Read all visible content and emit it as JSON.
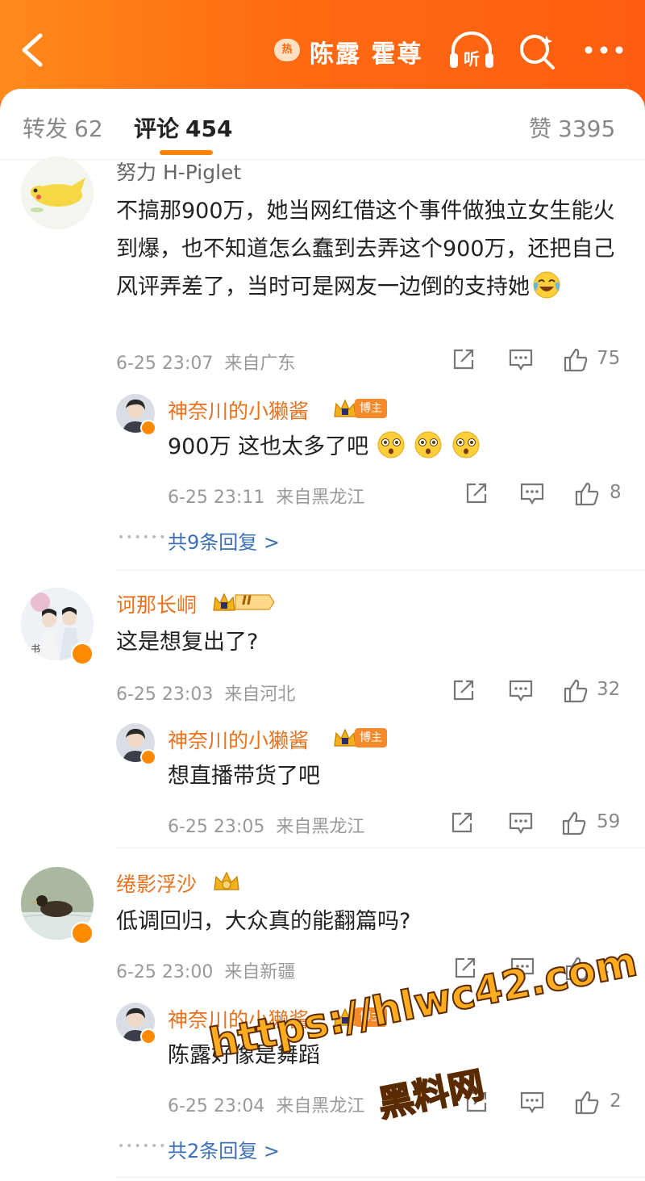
{
  "header": {
    "hot_badge": "热",
    "topic_title": "陈露 霍尊",
    "listen_label": "听"
  },
  "tabs": [
    {
      "label": "转发",
      "count": "62"
    },
    {
      "label": "评论",
      "count": "454"
    },
    {
      "label": "赞",
      "count": "3395"
    }
  ],
  "comments": [
    {
      "user": "努力 H-Piglet",
      "text": "不搞那900万，她当网红借这个事件做独立女生能火到爆，也不知道怎么蠢到去弄这个900万，还把自己风评弄差了，当时可是网友一边倒的支持她",
      "emoji": "laugh-cry-emoji",
      "time": "6-25 23:07",
      "location": "来自广东",
      "likes": "75",
      "reply": {
        "user": "神奈川的小獭酱",
        "badge": "博主",
        "text": "900万 这也太多了吧",
        "time": "6-25 23:11",
        "location": "来自黑龙江",
        "likes": "8"
      },
      "more_replies": "共9条回复 >"
    },
    {
      "user": "诃那长峒",
      "level_badge": "II",
      "text": "这是想复出了?",
      "time": "6-25 23:03",
      "location": "来自河北",
      "likes": "32",
      "reply": {
        "user": "神奈川的小獭酱",
        "badge": "博主",
        "text": "想直播带货了吧",
        "time": "6-25 23:05",
        "location": "来自黑龙江",
        "likes": "59"
      }
    },
    {
      "user": "绻影浮沙",
      "text": "低调回归，大众真的能翻篇吗?",
      "time": "6-25 23:00",
      "location": "来自新疆",
      "likes": "10",
      "reply": {
        "user": "神奈川的小獭酱",
        "badge": "博主",
        "text": "陈露好像是舞蹈",
        "time": "6-25 23:04",
        "location": "来自黑龙江",
        "likes": "2"
      },
      "more_replies": "共2条回复 >"
    }
  ],
  "watermark": {
    "url": "https://hlwc42.com",
    "name": "黑料网"
  },
  "colors": {
    "accent": "#ff8200",
    "username": "#e8711e",
    "link": "#3b6fb6"
  }
}
